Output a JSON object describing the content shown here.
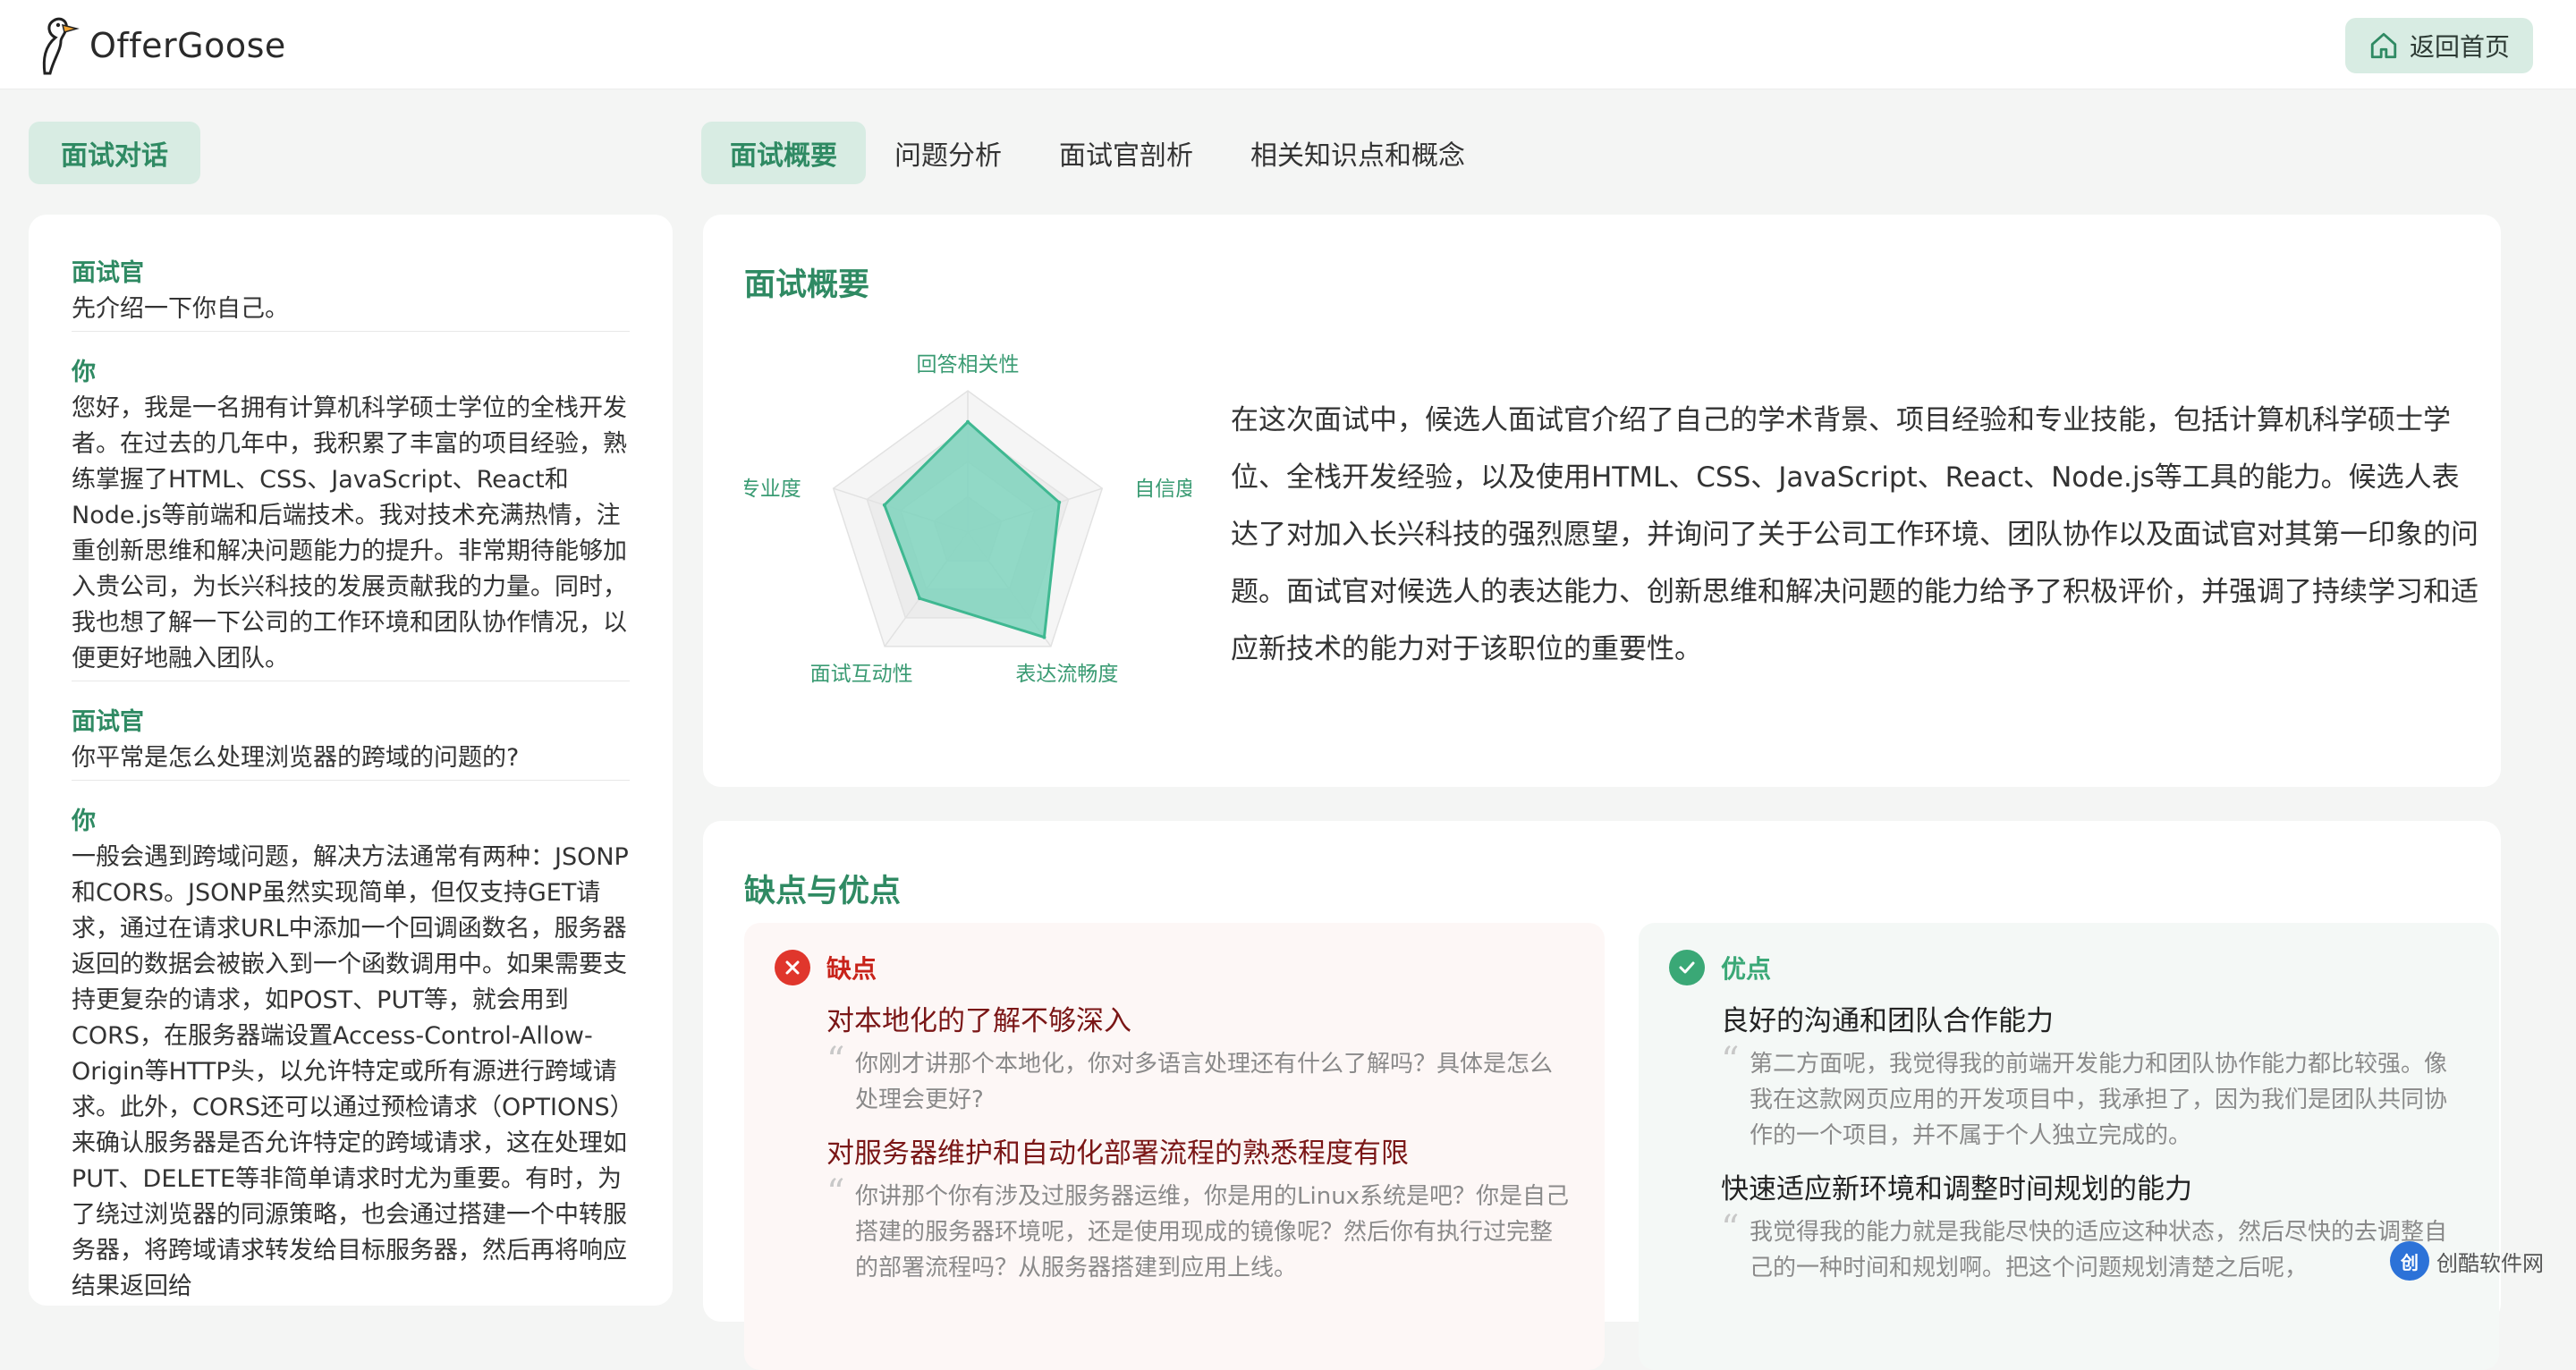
{
  "app": {
    "brand": "OfferGoose",
    "home_button": "返回首页"
  },
  "left_tab": "面试对话",
  "tabs": [
    {
      "label": "面试概要",
      "active": true
    },
    {
      "label": "问题分析",
      "active": false
    },
    {
      "label": "面试官剖析",
      "active": false
    },
    {
      "label": "相关知识点和概念",
      "active": false
    }
  ],
  "conversation": [
    {
      "speaker": "面试官",
      "text": "先介绍一下你自己。"
    },
    {
      "speaker": "你",
      "text": "您好，我是一名拥有计算机科学硕士学位的全栈开发者。在过去的几年中，我积累了丰富的项目经验，熟练掌握了HTML、CSS、JavaScript、React和Node.js等前端和后端技术。我对技术充满热情，注重创新思维和解决问题能力的提升。非常期待能够加入贵公司，为长兴科技的发展贡献我的力量。同时，我也想了解一下公司的工作环境和团队协作情况，以便更好地融入团队。"
    },
    {
      "speaker": "面试官",
      "text": "你平常是怎么处理浏览器的跨域的问题的?"
    },
    {
      "speaker": "你",
      "text": "一般会遇到跨域问题，解决方法通常有两种：JSONP和CORS。JSONP虽然实现简单，但仅支持GET请求，通过在请求URL中添加一个回调函数名，服务器返回的数据会被嵌入到一个函数调用中。如果需要支持更复杂的请求，如POST、PUT等，就会用到CORS，在服务器端设置Access-Control-Allow-Origin等HTTP头，以允许特定或所有源进行跨域请求。此外，CORS还可以通过预检请求（OPTIONS）来确认服务器是否允许特定的跨域请求，这在处理如PUT、DELETE等非简单请求时尤为重要。有时，为了绕过浏览器的同源策略，也会通过搭建一个中转服务器，将跨域请求转发给目标服务器，然后再将响应结果返回给"
    }
  ],
  "overview": {
    "title": "面试概要",
    "summary": "在这次面试中，候选人面试官介绍了自己的学术背景、项目经验和专业技能，包括计算机科学硕士学位、全栈开发经验，以及使用HTML、CSS、JavaScript、React、Node.js等工具的能力。候选人表达了对加入长兴科技的强烈愿望，并询问了关于公司工作环境、团队协作以及面试官对其第一印象的问题。面试官对候选人的表达能力、创新思维和解决问题的能力给予了积极评价，并强调了持续学习和适应新技术的能力对于该职位的重要性。"
  },
  "chart_data": {
    "type": "radar",
    "categories": [
      "回答相关性",
      "自信度",
      "表达流畅度",
      "面试互动性",
      "专业度"
    ],
    "values": [
      0.78,
      0.68,
      0.92,
      0.58,
      0.62
    ],
    "range": [
      0,
      1
    ],
    "grid_levels": 4,
    "fill_color": "#7fd3bd",
    "stroke_color": "#3fb891"
  },
  "pros_cons": {
    "title": "缺点与优点",
    "cons": {
      "label": "缺点",
      "items": [
        {
          "title": "对本地化的了解不够深入",
          "quote": "你刚才讲那个本地化，你对多语言处理还有什么了解吗？具体是怎么处理会更好?"
        },
        {
          "title": "对服务器维护和自动化部署流程的熟悉程度有限",
          "quote": "你讲那个你有涉及过服务器运维，你是用的Linux系统是吧？你是自己搭建的服务器环境呢，还是使用现成的镜像呢？然后你有执行过完整的部署流程吗？从服务器搭建到应用上线。"
        }
      ]
    },
    "pros": {
      "label": "优点",
      "items": [
        {
          "title": "良好的沟通和团队合作能力",
          "quote": "第二方面呢，我觉得我的前端开发能力和团队协作能力都比较强。像我在这款网页应用的开发项目中，我承担了，因为我们是团队共同协作的一个项目，并不属于个人独立完成的。"
        },
        {
          "title": "快速适应新环境和调整时间规划的能力",
          "quote": "我觉得我的能力就是我能尽快的适应这种状态，然后尽快的去调整自己的一种时间和规划啊。把这个问题规划清楚之后呢，"
        }
      ]
    }
  },
  "watermark": {
    "logo": "创",
    "text": "创酷软件网"
  },
  "colors": {
    "accent": "#2f8a63",
    "accent_bg": "#d8ece3",
    "cons_red": "#e0362c",
    "pros_green": "#3aa876"
  }
}
